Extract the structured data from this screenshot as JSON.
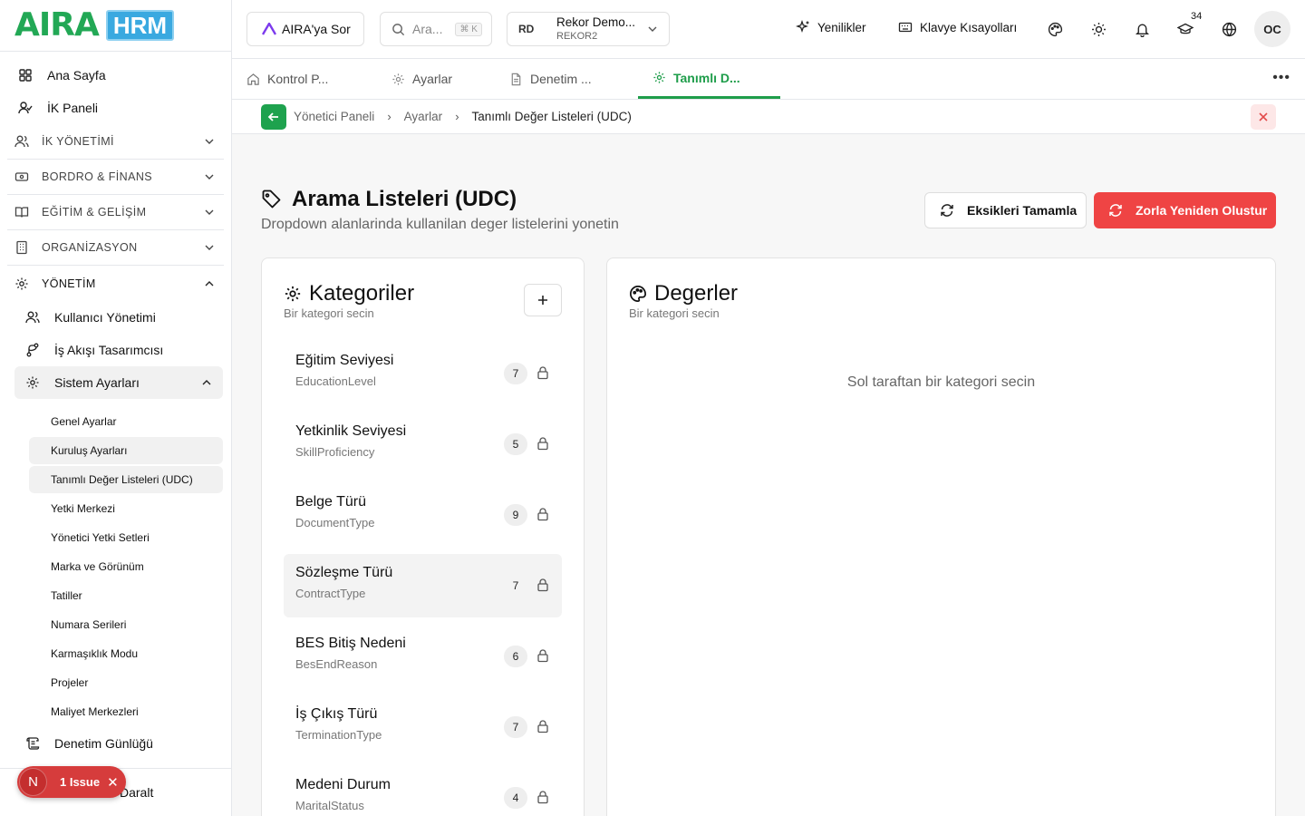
{
  "brand": {
    "name": "AIRA",
    "product": "HRM",
    "accent": "#1e9d4a",
    "danger": "#ef4444"
  },
  "sidebar": {
    "top_items": [
      {
        "label": "Ana Sayfa",
        "icon": "grid-icon"
      },
      {
        "label": "İK Paneli",
        "icon": "user-check-icon"
      }
    ],
    "sections": [
      {
        "label": "İK YÖNETİMİ",
        "icon": "users-icon"
      },
      {
        "label": "BORDRO & FİNANS",
        "icon": "wallet-icon"
      },
      {
        "label": "EĞİTİM & GELİŞİM",
        "icon": "book-icon"
      },
      {
        "label": "ORGANİZASYON",
        "icon": "building-icon"
      },
      {
        "label": "YÖNETİM",
        "icon": "gear-icon"
      }
    ],
    "management_items": [
      {
        "label": "Kullanıcı Yönetimi",
        "icon": "users-icon"
      },
      {
        "label": "İş Akışı Tasarımcısı",
        "icon": "workflow-icon"
      },
      {
        "label": "Sistem Ayarları",
        "icon": "gear-icon"
      }
    ],
    "settings_leaves": [
      "Genel Ayarlar",
      "Kuruluş Ayarları",
      "Tanımlı Değer Listeleri (UDC)",
      "Yetki Merkezi",
      "Yönetici Yetki Setleri",
      "Marka ve Görünüm",
      "Tatiller",
      "Numara Serileri",
      "Karmaşıklık Modu",
      "Projeler",
      "Maliyet Merkezleri"
    ],
    "audit_item": "Denetim Günlüğü",
    "footer_text": "Daralt",
    "issue": {
      "letter": "N",
      "label": "1 Issue"
    }
  },
  "header": {
    "ask_label": "AIRA'ya Sor",
    "search_placeholder": "Ara...",
    "search_shortcut": "⌘ K",
    "org": {
      "initials": "RD",
      "name": "Rekor Demo...",
      "code": "REKOR2"
    },
    "whats_new": "Yenilikler",
    "shortcuts": "Klavye Kısayolları",
    "notification_count": "34",
    "user_initials": "OC"
  },
  "tabs": [
    {
      "label": "Kontrol P...",
      "icon": "home-icon",
      "active": false
    },
    {
      "label": "Ayarlar",
      "icon": "gear-icon",
      "active": false
    },
    {
      "label": "Denetim ...",
      "icon": "file-icon",
      "active": false
    },
    {
      "label": "Tanımlı D...",
      "icon": "gear-icon",
      "active": true
    }
  ],
  "breadcrumb": [
    "Yönetici Paneli",
    "Ayarlar",
    "Tanımlı Değer Listeleri (UDC)"
  ],
  "page": {
    "title": "Arama Listeleri (UDC)",
    "subtitle": "Dropdown alanlarinda kullanilan deger listelerini yonetin",
    "btn_complete": "Eksikleri Tamamla",
    "btn_force": "Zorla Yeniden Olustur"
  },
  "categories": {
    "title": "Kategoriler",
    "subtitle": "Bir kategori secin",
    "items": [
      {
        "name": "Eğitim Seviyesi",
        "code": "EducationLevel",
        "count": "7",
        "selected": false
      },
      {
        "name": "Yetkinlik Seviyesi",
        "code": "SkillProficiency",
        "count": "5",
        "selected": false
      },
      {
        "name": "Belge Türü",
        "code": "DocumentType",
        "count": "9",
        "selected": false
      },
      {
        "name": "Sözleşme Türü",
        "code": "ContractType",
        "count": "7",
        "selected": true
      },
      {
        "name": "BES Bitiş Nedeni",
        "code": "BesEndReason",
        "count": "6",
        "selected": false
      },
      {
        "name": "İş Çıkış Türü",
        "code": "TerminationType",
        "count": "7",
        "selected": false
      },
      {
        "name": "Medeni Durum",
        "code": "MaritalStatus",
        "count": "4",
        "selected": false
      }
    ]
  },
  "values": {
    "title": "Degerler",
    "subtitle": "Bir kategori secin",
    "empty": "Sol taraftan bir kategori secin"
  }
}
